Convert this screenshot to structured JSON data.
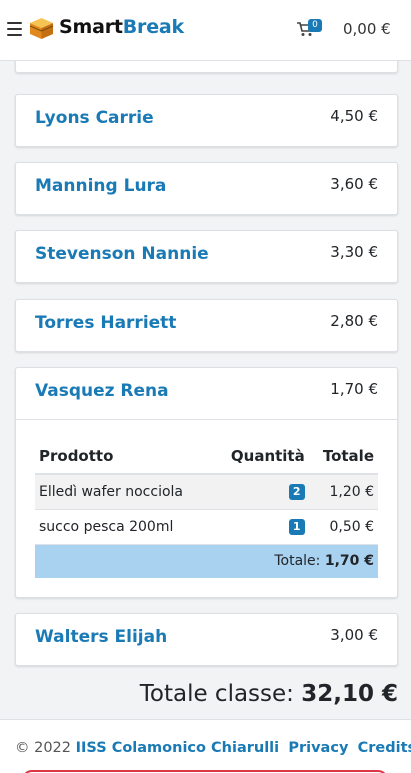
{
  "header": {
    "brand_part1": "Smart",
    "brand_part2": "Break",
    "cart_count": "0",
    "cart_total": "0,00 €",
    "icons": [
      "hamburger-menu-icon",
      "logo-icon",
      "cart-icon"
    ]
  },
  "students": [
    {
      "name": "Lyons Carrie",
      "amount": "4,50 €"
    },
    {
      "name": "Manning Lura",
      "amount": "3,60 €"
    },
    {
      "name": "Stevenson Nannie",
      "amount": "3,30 €"
    },
    {
      "name": "Torres Harriett",
      "amount": "2,80 €"
    },
    {
      "name": "Vasquez Rena",
      "amount": "1,70 €"
    },
    {
      "name": "Walters Elijah",
      "amount": "3,00 €"
    }
  ],
  "order_table": {
    "headers": {
      "product": "Prodotto",
      "quantity": "Quantità",
      "total": "Totale"
    },
    "rows": [
      {
        "product": "Elledì wafer nocciola",
        "quantity": "2",
        "total": "1,20 €"
      },
      {
        "product": "succo pesca 200ml",
        "quantity": "1",
        "total": "0,50 €"
      }
    ],
    "total_label": "Totale:",
    "total_value": "1,70 €"
  },
  "class_total": {
    "label": "Totale classe:",
    "value": "32,10 €"
  },
  "footer": {
    "copyright": "© 2022",
    "school_link": "IISS Colamonico Chiarulli",
    "privacy_link": "Privacy",
    "credits_link": "Credits"
  },
  "colors": {
    "accent": "#1a7ab5",
    "total_row_bg": "#a9d1f0",
    "danger": "#dc3545"
  }
}
